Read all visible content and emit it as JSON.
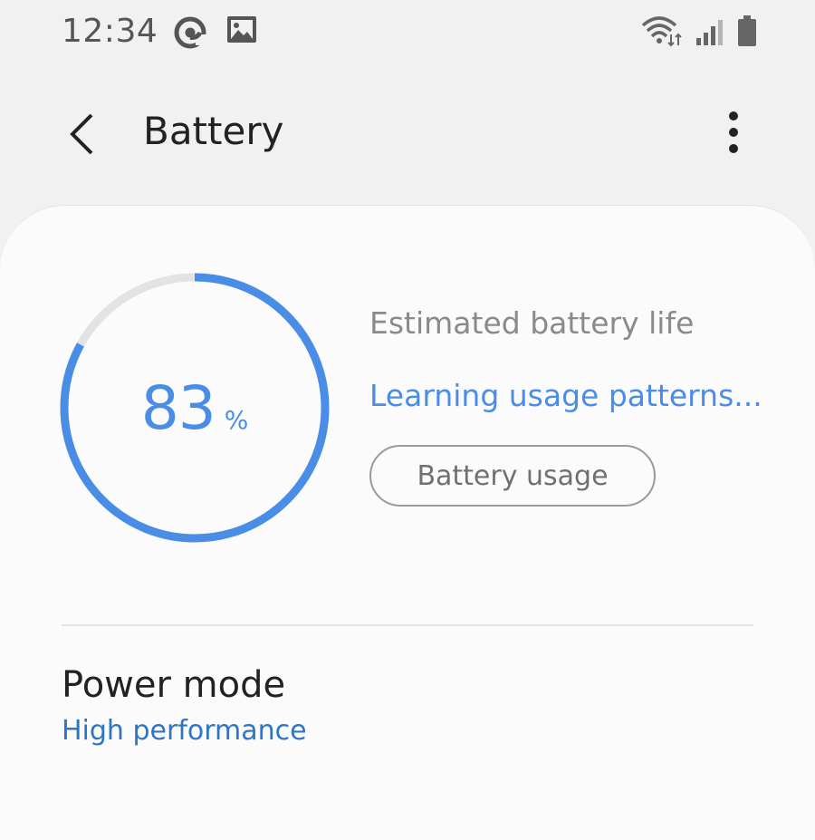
{
  "status_bar": {
    "time": "12:34",
    "left_icons": [
      "at-notification-icon",
      "gallery-image-icon"
    ],
    "right_icons": [
      "wifi-icon",
      "cell-signal-icon",
      "battery-icon"
    ]
  },
  "header": {
    "title": "Battery",
    "back_icon": "chevron-left-icon",
    "more_icon": "more-vertical-icon"
  },
  "battery": {
    "level_percent": 83,
    "level_value": "83",
    "level_unit": "%",
    "estimate_label": "Estimated battery life",
    "estimate_status": "Learning usage patterns...",
    "usage_button_label": "Battery usage"
  },
  "power_mode": {
    "title": "Power mode",
    "value": "High performance"
  },
  "colors": {
    "accent": "#4a8de6",
    "link": "#2f75c5",
    "track": "#e3e3e3",
    "background": "#f1f1f1",
    "card": "#fbfbfb"
  }
}
